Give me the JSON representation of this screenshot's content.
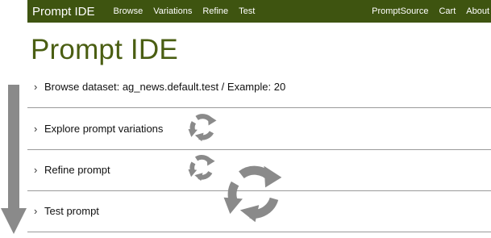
{
  "navbar": {
    "brand": "Prompt IDE",
    "left_links": [
      "Browse",
      "Variations",
      "Refine",
      "Test"
    ],
    "right_links": [
      "PromptSource",
      "Cart",
      "About"
    ],
    "background": "#3e5410"
  },
  "title": "Prompt IDE",
  "sections": [
    {
      "label": "Browse dataset: ag_news.default.test / Example: 20",
      "expanded": false
    },
    {
      "label": "Explore prompt variations",
      "expanded": false
    },
    {
      "label": "Refine prompt",
      "expanded": false
    },
    {
      "label": "Test prompt",
      "expanded": false
    }
  ],
  "chevron": "›",
  "icons": {
    "progress_arrow": "arrow-down-icon",
    "refresh": "refresh-cycle-icon"
  },
  "colors": {
    "accent": "#3e5410",
    "title": "#4a5e12",
    "icon_gray": "#8a8a8a"
  }
}
